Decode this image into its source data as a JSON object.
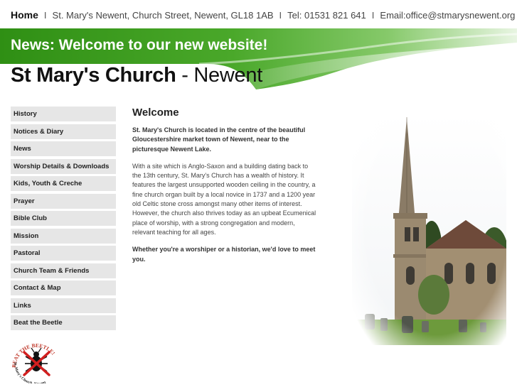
{
  "topbar": {
    "home": "Home",
    "separator": "I",
    "address": "St. Mary's Newent, Church Street, Newent, GL18 1AB",
    "phone": "Tel: 01531 821 641",
    "email": "Email:office@stmarysnewent.org"
  },
  "banner": {
    "news": "News: Welcome to our new website!",
    "title_strong": "St Mary's Church",
    "title_rest": " - Newent",
    "green_color": "#3f9e1f"
  },
  "nav": {
    "items": [
      "History",
      "Notices & Diary",
      "News",
      "Worship Details & Downloads",
      "Kids, Youth & Creche",
      "Prayer",
      "Bible Club",
      "Mission",
      "Pastoral",
      "Church Team & Friends",
      "Contact & Map",
      "Links",
      "Beat the Beetle"
    ]
  },
  "logo": {
    "top_text": "BEAT THE BEETLE!",
    "bottom_text": "St. Mary's Church, Newent"
  },
  "main": {
    "heading": "Welcome",
    "intro": "St. Mary's Church is located in the centre of the beautiful Gloucestershire market town of Newent, near to the picturesque Newent Lake.",
    "body": "With a site which is Anglo-Saxon and a building dating back to the 13th century, St. Mary's Church has a wealth of history. It features the largest unsupported wooden ceiling in the country, a fine church organ built by a local novice in 1737 and a 1200 year old Celtic stone cross amongst many other items of interest. However, the church also thrives today as an upbeat Ecumenical place of worship, with a strong congregation and modern, relevant teaching for all ages.",
    "closing": "Whether you're a worshiper or a historian, we'd love to meet you."
  }
}
